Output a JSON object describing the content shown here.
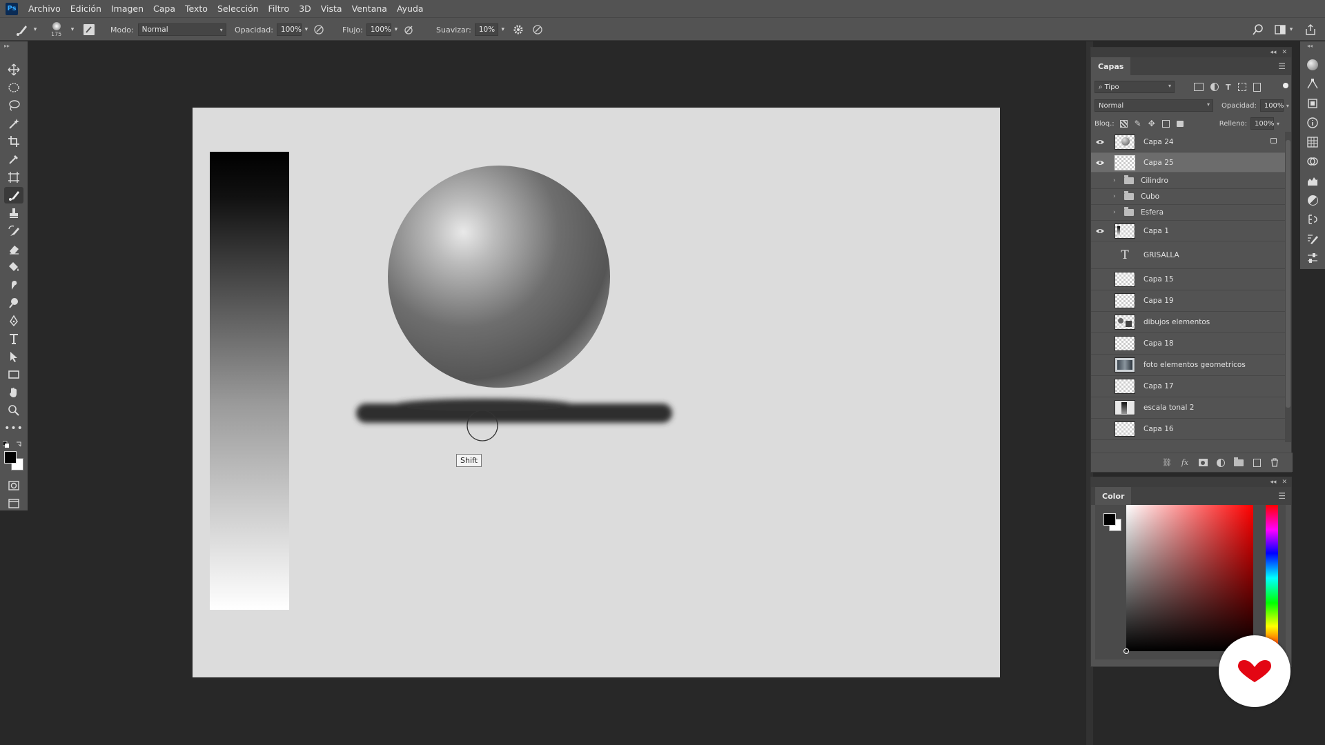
{
  "app": {
    "logo": "Ps"
  },
  "menu": [
    "Archivo",
    "Edición",
    "Imagen",
    "Capa",
    "Texto",
    "Selección",
    "Filtro",
    "3D",
    "Vista",
    "Ventana",
    "Ayuda"
  ],
  "options": {
    "brush_size": "175",
    "mode_label": "Modo:",
    "mode_value": "Normal",
    "opacity_label": "Opacidad:",
    "opacity_value": "100%",
    "flow_label": "Flujo:",
    "flow_value": "100%",
    "smoothing_label": "Suavizar:",
    "smoothing_value": "10%"
  },
  "canvas": {
    "tooltip": "Shift"
  },
  "layers_panel": {
    "tab": "Capas",
    "filter_value": "Tipo",
    "blend_mode": "Normal",
    "opacity_label": "Opacidad:",
    "opacity_value": "100%",
    "lock_label": "Bloq.:",
    "fill_label": "Relleno:",
    "fill_value": "100%",
    "layers": [
      {
        "name": "Capa 24",
        "visible": true,
        "kind": "pixel",
        "locked": true
      },
      {
        "name": "Capa 25",
        "visible": true,
        "kind": "pixel",
        "selected": true
      },
      {
        "name": "Cilindro",
        "visible": false,
        "kind": "group"
      },
      {
        "name": "Cubo",
        "visible": false,
        "kind": "group"
      },
      {
        "name": "Esfera",
        "visible": false,
        "kind": "group"
      },
      {
        "name": "Capa 1",
        "visible": true,
        "kind": "pixel"
      },
      {
        "name": "GRISALLA",
        "visible": false,
        "kind": "text"
      },
      {
        "name": "Capa 15",
        "visible": false,
        "kind": "pixel"
      },
      {
        "name": "Capa 19",
        "visible": false,
        "kind": "pixel"
      },
      {
        "name": "dibujos elementos",
        "visible": false,
        "kind": "image"
      },
      {
        "name": "Capa 18",
        "visible": false,
        "kind": "pixel"
      },
      {
        "name": "foto elementos geometricos",
        "visible": false,
        "kind": "image"
      },
      {
        "name": "Capa 17",
        "visible": false,
        "kind": "pixel"
      },
      {
        "name": "escala tonal 2",
        "visible": false,
        "kind": "image"
      },
      {
        "name": "Capa 16",
        "visible": false,
        "kind": "pixel"
      },
      {
        "name": "",
        "visible": false,
        "kind": "pixel"
      }
    ]
  },
  "color_panel": {
    "tab": "Color"
  },
  "colors": {
    "ui_bg": "#535353",
    "workspace": "#282828",
    "canvas": "#dcdcdc",
    "accent_logo": "#e30613"
  }
}
